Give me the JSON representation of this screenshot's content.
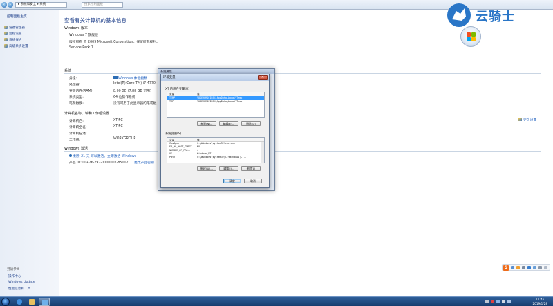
{
  "address": {
    "breadcrumb": "▸ 系统和安全 ▸ 系统",
    "search_placeholder": "搜索控制面板"
  },
  "sidebar": {
    "home": "控制面板主页",
    "links": [
      "设备管理器",
      "远程设置",
      "系统保护",
      "高级系统设置"
    ],
    "see_also": "另请参阅",
    "bottom_links": [
      "操作中心",
      "Windows Update",
      "性能信息和工具"
    ]
  },
  "main": {
    "title": "查看有关计算机的基本信息",
    "edition_section": "Windows 版本",
    "edition": "Windows 7 旗舰版",
    "copyright": "版权所有 © 2009 Microsoft Corporation。保留所有权利。",
    "service_pack": "Service Pack 1",
    "system_section": "系统",
    "system_rows": [
      {
        "label": "分级:",
        "value": "Windows 体验指数"
      },
      {
        "label": "处理器:",
        "value": "Intel(R) Core(TM) i7-4770"
      },
      {
        "label": "安装内存(RAM):",
        "value": "8.00 GB (7.88 GB 可用)"
      },
      {
        "label": "系统类型:",
        "value": "64 位操作系统"
      },
      {
        "label": "笔和触摸:",
        "value": "没有可用于此显示器的笔或触"
      }
    ],
    "name_section": "计算机名称、域和工作组设置",
    "name_rows": [
      {
        "label": "计算机名:",
        "value": "XT-PC"
      },
      {
        "label": "计算机全名:",
        "value": "XT-PC"
      },
      {
        "label": "计算机描述:",
        "value": ""
      },
      {
        "label": "工作组:",
        "value": "WORKGROUP"
      }
    ],
    "change_settings": "更改设置",
    "activation_section": "Windows 激活",
    "activation_text": "剩余 21 天 可以激活。立即激活 Windows",
    "product_id": "产品 ID: 00426-292-0000007-85002",
    "change_key": "更改产品密钥"
  },
  "watermark": {
    "text": "云骑士"
  },
  "sysprops": {
    "title": "系统属性"
  },
  "envdialog": {
    "title": "环境变量",
    "close": "✕",
    "user_group": "XT 的用户变量(U)",
    "col_var": "变量",
    "col_val": "值",
    "user_vars": [
      {
        "name": "TEMP",
        "value": "%USERPROFILE%\\AppData\\Local\\Temp",
        "selected": true
      },
      {
        "name": "TMP",
        "value": "%USERPROFILE%\\AppData\\Local\\Temp",
        "selected": false
      }
    ],
    "user_buttons": [
      "新建(N)...",
      "编辑(E)...",
      "删除(D)"
    ],
    "sys_group": "系统变量(S)",
    "sys_vars": [
      {
        "name": "ComSpec",
        "value": "C:\\Windows\\system32\\cmd.exe"
      },
      {
        "name": "FP_NO_HOST_CHECK",
        "value": "NO"
      },
      {
        "name": "NUMBER_OF_PRO...",
        "value": "4"
      },
      {
        "name": "OS",
        "value": "Windows_NT"
      },
      {
        "name": "Path",
        "value": "C:\\Windows\\system32;C:\\Windows;C..."
      }
    ],
    "sys_buttons": [
      "新建(W)...",
      "编辑(I)...",
      "删除(L)"
    ],
    "ok": "确定",
    "cancel": "取消"
  },
  "taskbar": {
    "time": "11:46",
    "date": "2019/1/28"
  },
  "tray": {
    "ime": "S"
  }
}
